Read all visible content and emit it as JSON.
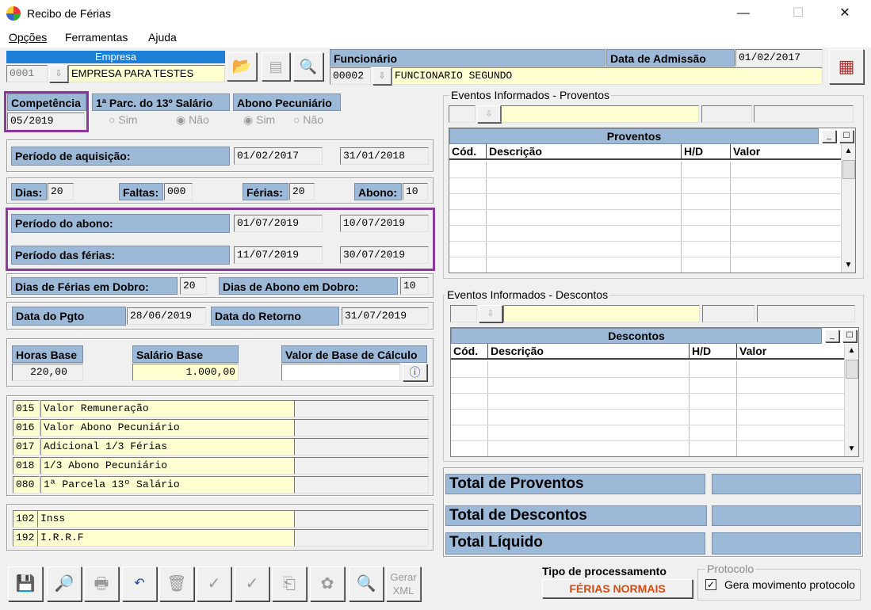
{
  "window": {
    "title": "Recibo de Férias",
    "minimize": "—",
    "maximize": "☐",
    "close": "✕"
  },
  "menu": [
    "Opções",
    "Ferramentas",
    "Ajuda"
  ],
  "empresa": {
    "label": "Empresa",
    "code": "0001",
    "name": "EMPRESA PARA TESTES"
  },
  "funcionario": {
    "label": "Funcionário",
    "code": "00002",
    "name": "FUNCIONARIO SEGUNDO",
    "admissao_label": "Data de Admissão",
    "admissao": "01/02/2017"
  },
  "competencia": {
    "label": "Competência",
    "value": "05/2019"
  },
  "parc13": {
    "label": "1ª Parc. do 13º Salário",
    "sim": "Sim",
    "nao": "Não"
  },
  "abono_pec": {
    "label": "Abono Pecuniário",
    "sim": "Sim",
    "nao": "Não"
  },
  "aquisicao": {
    "label": "Período de aquisição:",
    "start": "01/02/2017",
    "end": "31/01/2018"
  },
  "dias": {
    "label": "Dias:",
    "value": "20"
  },
  "faltas": {
    "label": "Faltas:",
    "value": "000"
  },
  "ferias": {
    "label": "Férias:",
    "value": "20"
  },
  "abono": {
    "label": "Abono:",
    "value": "10"
  },
  "periodo_abono": {
    "label": "Período do abono:",
    "start": "01/07/2019",
    "end": "10/07/2019"
  },
  "periodo_ferias": {
    "label": "Período das férias:",
    "start": "11/07/2019",
    "end": "30/07/2019"
  },
  "dias_ferias_dobro": {
    "label": "Dias de Férias em Dobro:",
    "value": "20"
  },
  "dias_abono_dobro": {
    "label": "Dias de Abono em Dobro:",
    "value": "10"
  },
  "data_pgto": {
    "label": "Data do Pgto",
    "value": "28/06/2019"
  },
  "data_retorno": {
    "label": "Data do Retorno",
    "value": "31/07/2019"
  },
  "horas_base": {
    "label": "Horas Base",
    "value": "220,00"
  },
  "salario_base": {
    "label": "Salário Base",
    "value": "1.000,00"
  },
  "valor_base": {
    "label": "Valor de Base de Cálculo",
    "value": ""
  },
  "proventos_list": [
    {
      "code": "015",
      "desc": "Valor Remuneração"
    },
    {
      "code": "016",
      "desc": "Valor Abono Pecuniário"
    },
    {
      "code": "017",
      "desc": "Adicional 1/3 Férias"
    },
    {
      "code": "018",
      "desc": "1/3 Abono Pecuniário"
    },
    {
      "code": "080",
      "desc": "1ª Parcela 13º Salário"
    }
  ],
  "descontos_list": [
    {
      "code": "102",
      "desc": "Inss"
    },
    {
      "code": "192",
      "desc": "I.R.R.F"
    }
  ],
  "eventos_proventos": {
    "title": "Eventos Informados - Proventos",
    "grid_title": "Proventos",
    "cols": [
      "Cód.",
      "Descrição",
      "H/D",
      "Valor"
    ]
  },
  "eventos_descontos": {
    "title": "Eventos Informados - Descontos",
    "grid_title": "Descontos",
    "cols": [
      "Cód.",
      "Descrição",
      "H/D",
      "Valor"
    ]
  },
  "totais": {
    "proventos": "Total de Proventos",
    "descontos": "Total de Descontos",
    "liquido": "Total Líquido"
  },
  "tipo": {
    "label": "Tipo de processamento",
    "value": "FÉRIAS NORMAIS"
  },
  "protocolo": {
    "label": "Protocolo",
    "checkbox": "Gera movimento protocolo",
    "checked": true
  },
  "toolbar": {
    "gerar_xml": "Gerar XML"
  }
}
